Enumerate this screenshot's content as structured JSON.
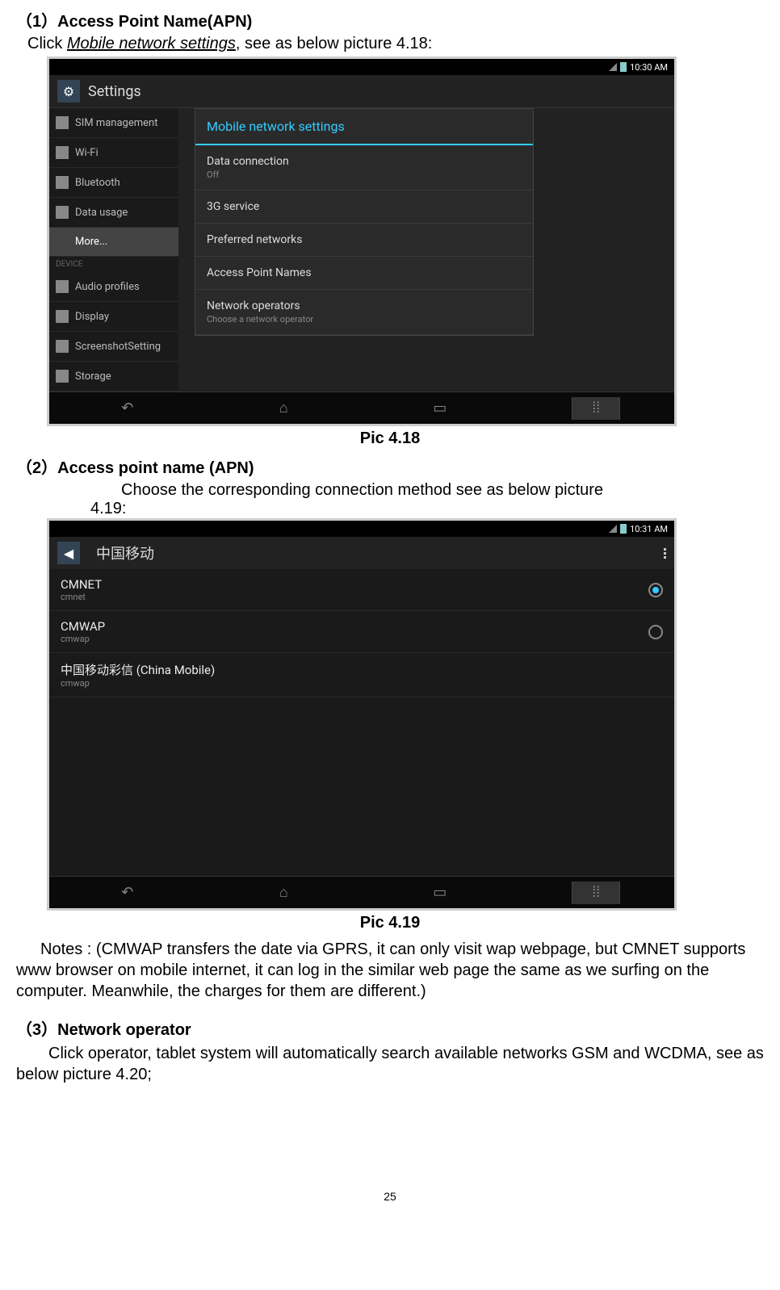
{
  "section1": {
    "header": "（1）Access Point Name(APN)",
    "instruction_prefix": "Click ",
    "instruction_italic": "Mobile network settings",
    "instruction_suffix": ", see as below picture 4.18:"
  },
  "screenshot1": {
    "time": "10:30 AM",
    "app_title": "Settings",
    "sidebar": [
      {
        "label": "SIM management",
        "icon": "sim"
      },
      {
        "label": "Wi-Fi",
        "icon": "wifi"
      },
      {
        "label": "Bluetooth",
        "icon": "bt"
      },
      {
        "label": "Data usage",
        "icon": "data"
      },
      {
        "label": "More...",
        "icon": "",
        "selected": true
      }
    ],
    "sidebar_divider": "DEVICE",
    "sidebar2": [
      {
        "label": "Audio profiles"
      },
      {
        "label": "Display"
      },
      {
        "label": "ScreenshotSetting"
      },
      {
        "label": "Storage"
      }
    ],
    "dialog": {
      "title": "Mobile network settings",
      "items": [
        {
          "label": "Data connection",
          "sub": "Off"
        },
        {
          "label": "3G service",
          "sub": ""
        },
        {
          "label": "Preferred networks",
          "sub": ""
        },
        {
          "label": "Access Point Names",
          "sub": ""
        },
        {
          "label": "Network operators",
          "sub": "Choose a network operator"
        }
      ]
    }
  },
  "caption1": "Pic 4.18",
  "section2": {
    "header": "（2）Access point name (APN)",
    "text1": "Choose the corresponding connection method see as below picture",
    "text2": "4.19:"
  },
  "screenshot2": {
    "time": "10:31 AM",
    "app_title": "中国移动",
    "apns": [
      {
        "title": "CMNET",
        "sub": "cmnet",
        "selected": true
      },
      {
        "title": "CMWAP",
        "sub": "cmwap",
        "selected": false
      },
      {
        "title": "中国移动彩信 (China Mobile)",
        "sub": "cmwap",
        "selected": false,
        "noradio": true
      }
    ]
  },
  "caption2": "Pic 4.19",
  "notes": "Notes : (CMWAP transfers the date via GPRS, it can only visit wap webpage, but CMNET supports www browser on mobile internet, it can log in the similar web page the same as we surfing on the computer. Meanwhile, the charges for them are different.)",
  "section3": {
    "header": "（3）Network operator",
    "text": "Click operator, tablet system will automatically search available networks GSM and WCDMA, see as below picture 4.20;"
  },
  "page_number": "25"
}
